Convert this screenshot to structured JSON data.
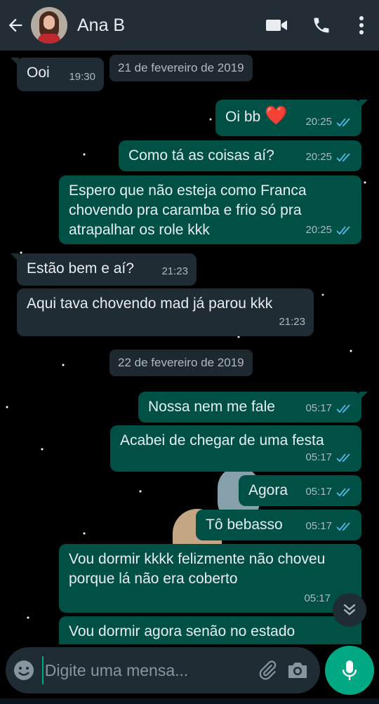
{
  "header": {
    "contact_name": "Ana B",
    "icons": [
      "back-arrow-icon",
      "video-call-icon",
      "phone-icon",
      "more-vert-icon"
    ]
  },
  "messages": [
    {
      "type": "in",
      "text": "Ooi",
      "time": "19:30"
    },
    {
      "type": "date",
      "text": "21 de fevereiro de 2019"
    },
    {
      "type": "out",
      "text": "Oi bb",
      "emoji": "❤️",
      "time": "20:25",
      "status": "read"
    },
    {
      "type": "out",
      "text": "Como tá as coisas aí?",
      "time": "20:25",
      "status": "read"
    },
    {
      "type": "out",
      "text": "Espero que não esteja como Franca chovendo pra caramba e frio só pra atrapalhar os role kkk",
      "time": "20:25",
      "status": "read"
    },
    {
      "type": "in",
      "text": "Estão bem e aí?",
      "time": "21:23"
    },
    {
      "type": "in",
      "text": "Aqui tava chovendo mad já parou kkk",
      "time": "21:23"
    },
    {
      "type": "date",
      "text": "22 de fevereiro de 2019"
    },
    {
      "type": "out",
      "text": "Nossa nem me fale",
      "time": "05:17",
      "status": "read"
    },
    {
      "type": "out",
      "text": "Acabei de chegar de uma festa",
      "time": "05:17",
      "status": "read"
    },
    {
      "type": "out",
      "text": "Agora",
      "time": "05:17",
      "status": "read"
    },
    {
      "type": "out",
      "text": "Tô bebasso",
      "time": "05:17",
      "status": "read"
    },
    {
      "type": "out",
      "text": "Vou dormir kkkk felizmente não choveu porque lá não era coberto",
      "time": "05:17"
    },
    {
      "type": "out",
      "text": "Vou dormir agora senão no estado"
    }
  ],
  "composer": {
    "placeholder": "Digite uma mensa...",
    "icons": [
      "emoji-icon",
      "attach-icon",
      "camera-icon",
      "mic-icon"
    ]
  },
  "colors": {
    "header_bg": "#232d36",
    "incoming_bubble": "#1f2c34",
    "outgoing_bubble": "#005046",
    "read_ticks": "#53bdeb",
    "accent": "#00a884"
  }
}
